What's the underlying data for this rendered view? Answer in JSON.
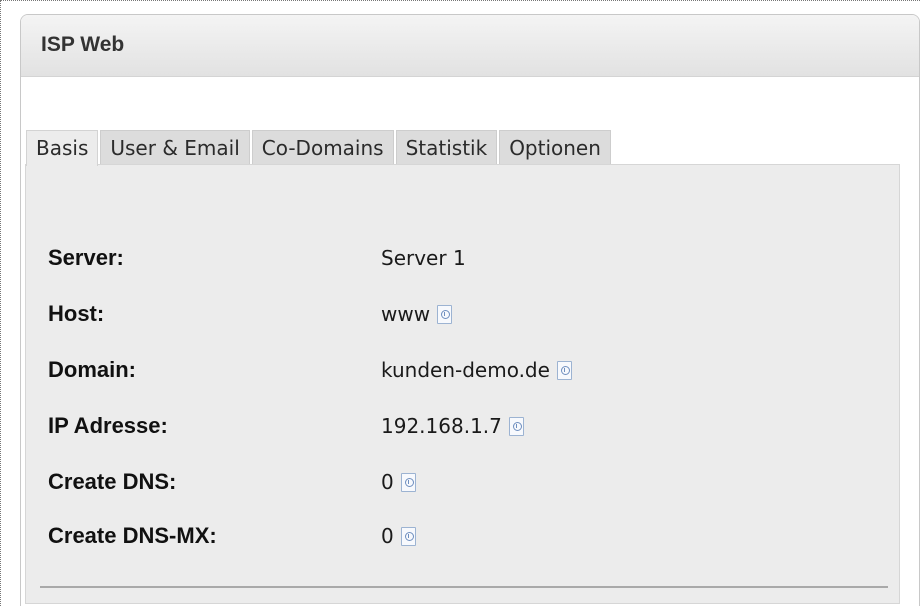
{
  "panel": {
    "title": "ISP Web"
  },
  "tabs": [
    {
      "label": "Basis",
      "active": true
    },
    {
      "label": "User & Email",
      "active": false
    },
    {
      "label": "Co-Domains",
      "active": false
    },
    {
      "label": "Statistik",
      "active": false
    },
    {
      "label": "Optionen",
      "active": false
    }
  ],
  "fields": [
    {
      "label": "Server:",
      "value": "Server 1",
      "info_icon": false
    },
    {
      "label": "Host:",
      "value": "www",
      "info_icon": true
    },
    {
      "label": "Domain:",
      "value": "kunden-demo.de",
      "info_icon": true
    },
    {
      "label": "IP Adresse:",
      "value": "192.168.1.7",
      "info_icon": true
    },
    {
      "label": "Create DNS:",
      "value": "0",
      "info_icon": true
    },
    {
      "label": "Create DNS-MX:",
      "value": "0",
      "info_icon": true
    }
  ]
}
